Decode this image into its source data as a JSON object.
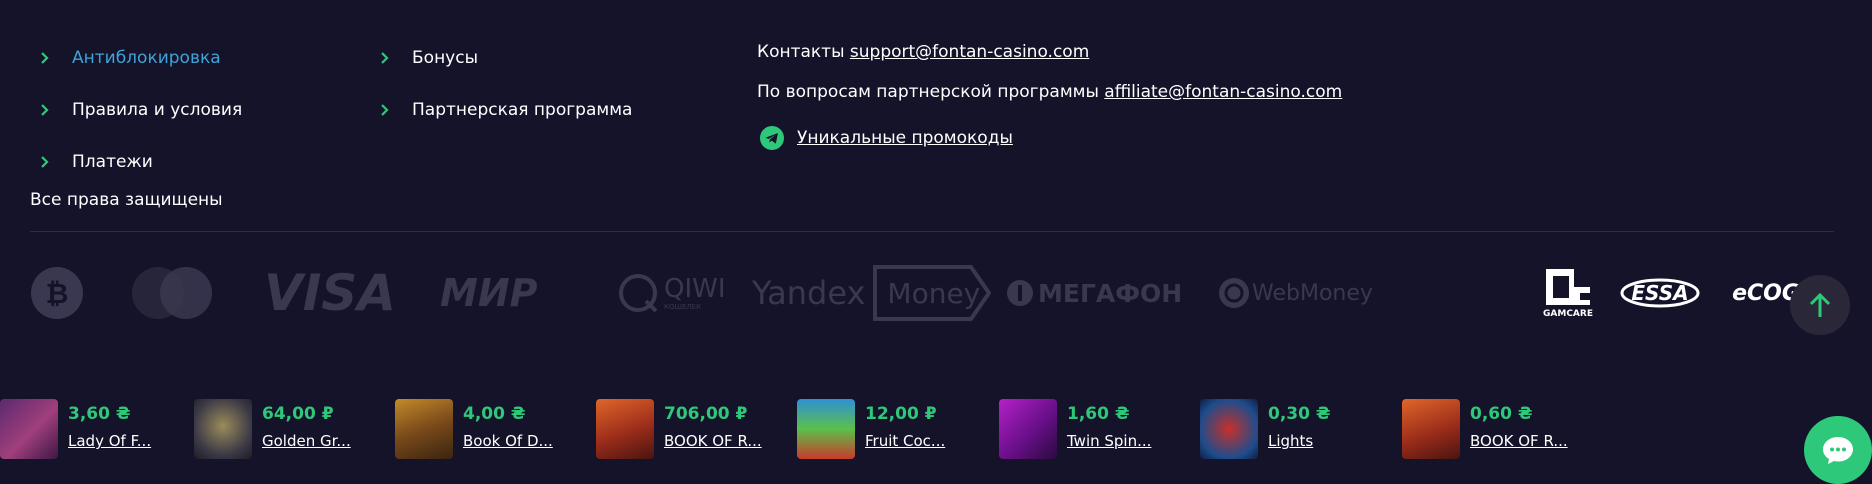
{
  "nav": {
    "col1": [
      {
        "label": "Антиблокировка",
        "active": true
      },
      {
        "label": "Правила и условия",
        "active": false
      },
      {
        "label": "Платежи",
        "active": false
      }
    ],
    "col2": [
      {
        "label": "Бонусы",
        "active": false
      },
      {
        "label": "Партнерская программа",
        "active": false
      }
    ]
  },
  "rights": "Все права защищены",
  "contacts": {
    "label": "Контакты",
    "email": "support@fontan-casino.com",
    "affiliate_label": "По вопросам партнерской программы",
    "affiliate_email": "affiliate@fontan-casino.com",
    "promo_link": "Уникальные промокоды"
  },
  "payments": {
    "visa": "VISA",
    "mir": "МИР",
    "qiwi": "QIWI",
    "qiwi_sub": "КОШЕЛЕК",
    "yandex": "Yandex",
    "money": "Money",
    "megafon": "МЕГАФОН",
    "webmoney": "WebMoney"
  },
  "certifications": {
    "gamcare": "GAMCARE",
    "essa": "ESSA",
    "ecogra": "eCOGRA"
  },
  "ticker": [
    {
      "amount": "3,60 ₴",
      "game": "Lady Of F..."
    },
    {
      "amount": "64,00 ₽",
      "game": "Golden Gr..."
    },
    {
      "amount": "4,00 ₴",
      "game": "Book Of D..."
    },
    {
      "amount": "706,00 ₽",
      "game": "BOOK OF R..."
    },
    {
      "amount": "12,00 ₽",
      "game": "Fruit Coc..."
    },
    {
      "amount": "1,60 ₴",
      "game": "Twin Spin..."
    },
    {
      "amount": "0,30 ₴",
      "game": "Lights"
    },
    {
      "amount": "0,60 ₴",
      "game": "BOOK OF R..."
    }
  ],
  "colors": {
    "background": "#15132a",
    "accent_green": "#2ec87a",
    "active_link": "#3ea3d8",
    "logo_gray": "#3a3850"
  }
}
